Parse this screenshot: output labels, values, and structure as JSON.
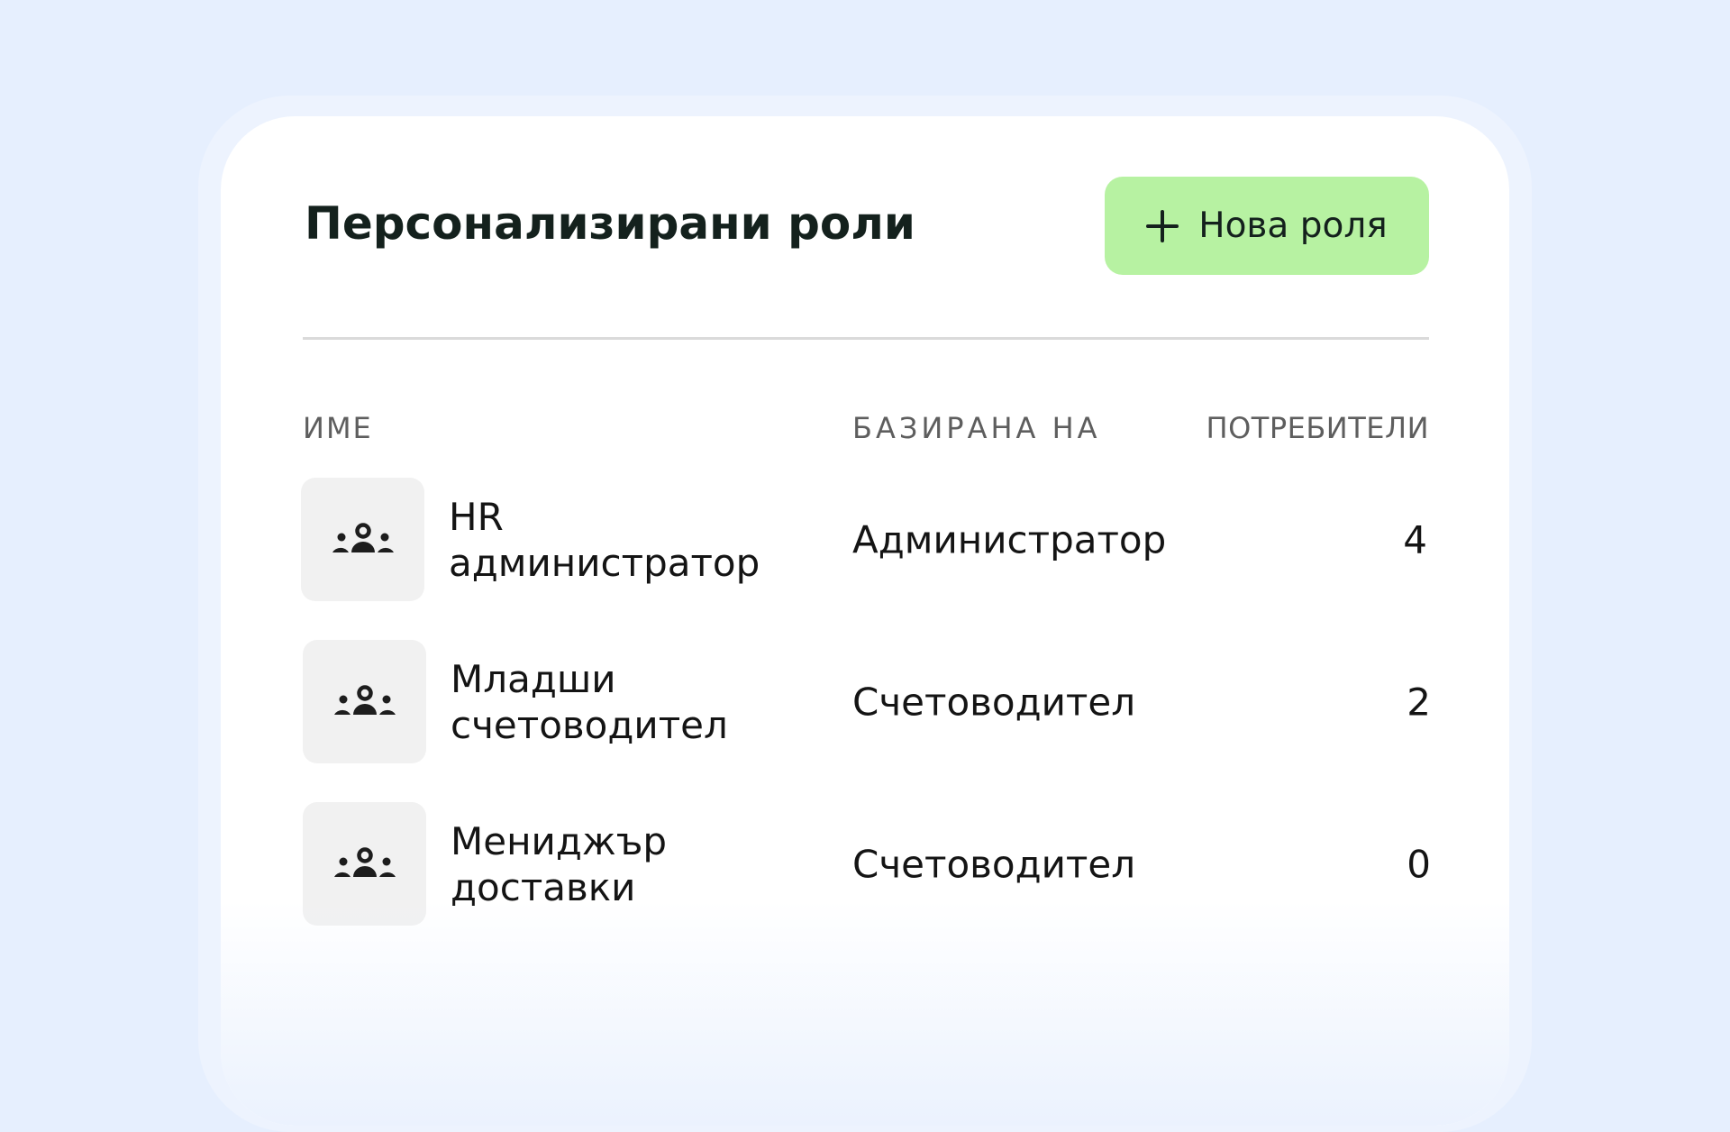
{
  "header": {
    "title": "Персонализирани роли",
    "new_role_label": "Нова роля",
    "new_role_icon": "plus-icon"
  },
  "table": {
    "columns": {
      "name": "ИМЕ",
      "based_on": "БАЗИРАНА НА",
      "users": "ПОТРЕБИТЕЛИ"
    },
    "rows": [
      {
        "icon": "users-group-icon",
        "name": "HR администратор",
        "based_on": "Администратор",
        "users": "4"
      },
      {
        "icon": "users-group-icon",
        "name": "Младши счетоводител",
        "based_on": "Счетоводител",
        "users": "2"
      },
      {
        "icon": "users-group-icon",
        "name": "Мениджър доставки",
        "based_on": "Счетоводител",
        "users": "0"
      }
    ]
  },
  "colors": {
    "background": "#e6effe",
    "card": "#ffffff",
    "button": "#b7f2a2",
    "icon_box": "#f1f1f1",
    "title_text": "#14211d",
    "header_text": "#5e5e5e"
  }
}
